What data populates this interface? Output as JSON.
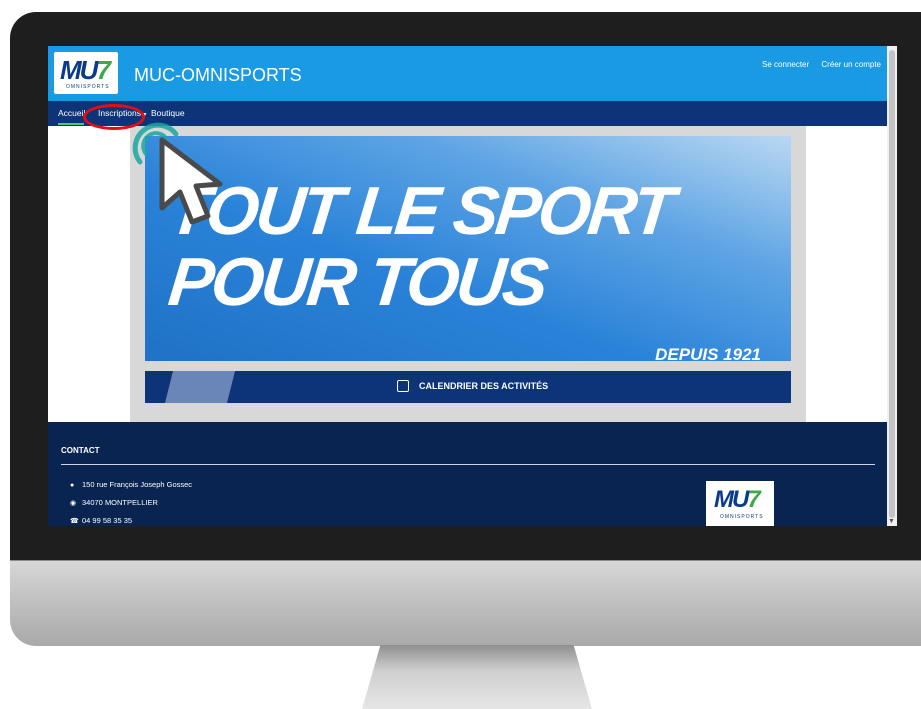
{
  "header": {
    "site_name": "MUC-OMNISPORTS",
    "logo_text": "MUC",
    "logo_sub": "OMNISPORTS",
    "links": [
      "Se connecter",
      "Créer un compte"
    ]
  },
  "nav": {
    "items": [
      {
        "label": "Accueil",
        "active": true
      },
      {
        "label": "Inscriptions",
        "has_dropdown": true
      },
      {
        "label": "Boutique"
      }
    ]
  },
  "banner": {
    "line1": "TOUT LE SPORT",
    "line2": "POUR TOUS",
    "since": "DEPUIS 1921"
  },
  "calendar_button": {
    "label": "CALENDRIER DES ACTIVITÉS",
    "icon": "calendar-icon"
  },
  "footer": {
    "title": "CONTACT",
    "lines": [
      {
        "icon": "map-marker-icon",
        "text": "150 rue François Joseph Gossec"
      },
      {
        "icon": "globe-icon",
        "text": "34070 MONTPELLIER"
      },
      {
        "icon": "phone-icon",
        "text": "04 99 58 35 35"
      }
    ]
  },
  "colors": {
    "topbar": "#1a9ae2",
    "navbar": "#0d3478",
    "footer": "#0a2451",
    "highlight": "#e10f14",
    "click_ring": "#1aa7a0",
    "nav_active_underline": "#4ccb6e"
  }
}
